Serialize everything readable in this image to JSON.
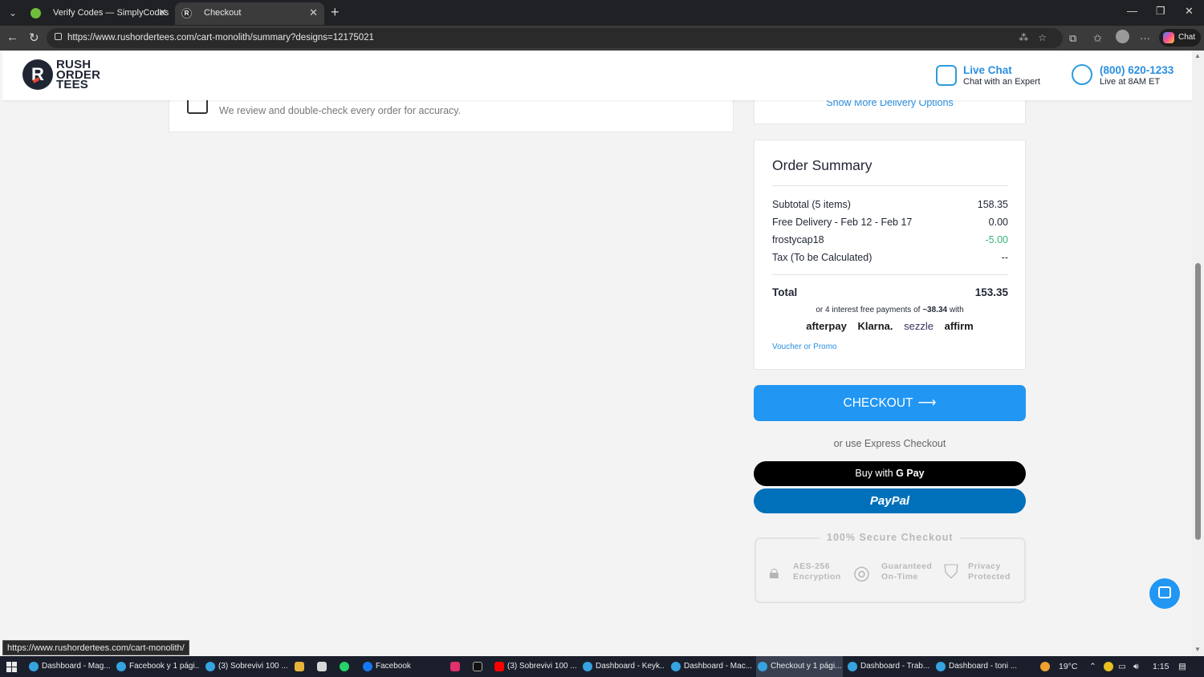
{
  "browser": {
    "tabs": [
      {
        "title": "Verify Codes — SimplyCodes",
        "active": false
      },
      {
        "title": "Checkout",
        "active": true
      }
    ],
    "url": "https://www.rushordertees.com/cart-monolith/summary?designs=12175021",
    "chat_label": "Chat",
    "status_url": "https://www.rushordertees.com/cart-monolith/"
  },
  "header": {
    "logo_lines": [
      "RUSH",
      "ORDER",
      "TEES"
    ],
    "live_chat_title": "Live Chat",
    "live_chat_sub": "Chat with an Expert",
    "phone": "(800) 620-1233",
    "phone_sub": "Live at 8AM ET"
  },
  "review": {
    "text": "We review and double-check every order for accuracy."
  },
  "delivery": {
    "more_options": "Show More Delivery Options"
  },
  "summary": {
    "title": "Order Summary",
    "rows": [
      {
        "label": "Subtotal (5 items)",
        "value": "158.35",
        "green": false
      },
      {
        "label": "Free Delivery - Feb 12 - Feb 17",
        "value": "0.00",
        "green": false
      },
      {
        "label": "frostycap18",
        "value": "-5.00",
        "green": true
      },
      {
        "label": "Tax (To be Calculated)",
        "value": "--",
        "green": false
      }
    ],
    "total_label": "Total",
    "total_value": "153.35",
    "installments_prefix": "or 4 interest free payments of",
    "installments_amount": "~38.34",
    "installments_suffix": "with",
    "pay_providers": [
      "afterpay",
      "Klarna.",
      "sezzle",
      "affirm"
    ],
    "voucher_label": "Voucher or Promo"
  },
  "checkout": {
    "button_label": "CHECKOUT",
    "express_label": "or use Express Checkout",
    "gpay_label_prefix": "Buy with",
    "gpay_label_brand": "G Pay",
    "paypal_label": "PayPal"
  },
  "secure": {
    "title": "100% Secure Checkout",
    "items": [
      {
        "line1": "AES-256",
        "line2": "Encryption",
        "icon": "lock-icon"
      },
      {
        "line1": "Guaranteed",
        "line2": "On-Time",
        "icon": "check-circle-icon"
      },
      {
        "line1": "Privacy",
        "line2": "Protected",
        "icon": "shield-check-icon"
      }
    ]
  },
  "taskbar": {
    "items": [
      "Dashboard - Mag...",
      "Facebook y 1 pági...",
      "(3) Sobrevivi 100 ...",
      "Facebook",
      "(3) Sobrevivi 100 ...",
      "Dashboard - Keyk...",
      "Dashboard - Mac...",
      "Checkout y 1 pági...",
      "Dashboard - Trab...",
      "Dashboard - toni ..."
    ],
    "temperature": "19°C",
    "time": "1:15"
  },
  "colors": {
    "accent": "#2196f3",
    "link": "#2a8fe0",
    "discount": "#36b37e",
    "paypal": "#0070ba"
  }
}
